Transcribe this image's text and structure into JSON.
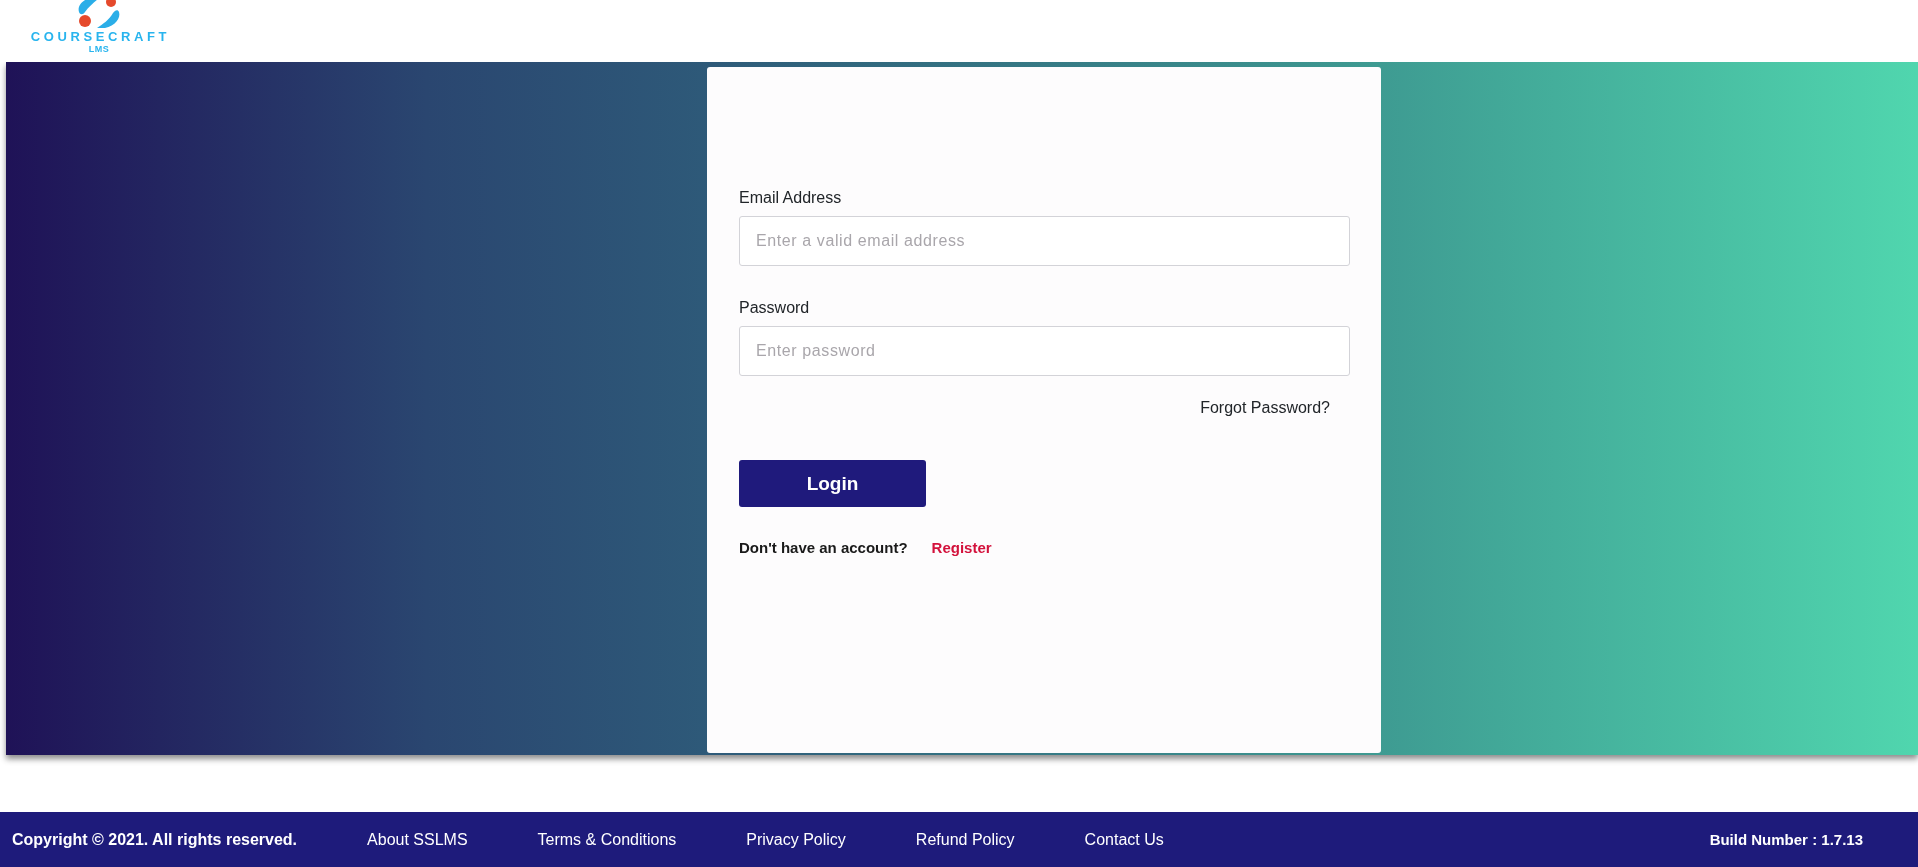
{
  "header": {
    "logo": {
      "name": "COURSECRAFT",
      "tagline": "LMS"
    }
  },
  "login_form": {
    "fields": [
      {
        "label": "Email Address",
        "placeholder": "Enter a valid email address"
      },
      {
        "label": "Password",
        "placeholder": "Enter password"
      }
    ],
    "forgot_link": "Forgot Password?",
    "submit_button": "Login",
    "register_prompt": "Don't have an account?",
    "register_link": "Register"
  },
  "footer": {
    "copyright": "Copyright © 2021. All rights reserved.",
    "links": [
      "About SSLMS",
      "Terms & Conditions",
      "Privacy Policy",
      "Refund Policy",
      "Contact Us"
    ],
    "build_number": "Build Number : 1.7.13"
  }
}
